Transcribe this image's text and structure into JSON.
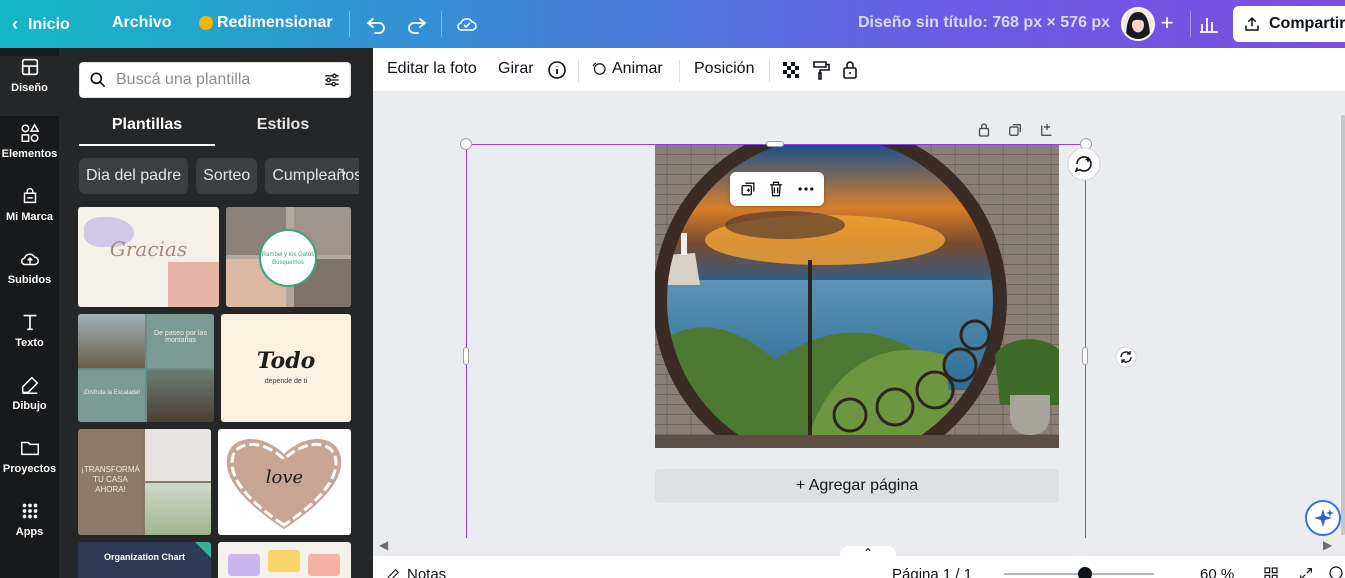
{
  "topbar": {
    "home_label": "Inicio",
    "file_label": "Archivo",
    "resize_label": "Redimensionar",
    "title": "Diseño sin título: 768 px × 576 px",
    "share_label": "Compartir"
  },
  "rail": {
    "items": [
      {
        "label": "Diseño",
        "icon": "layout-icon"
      },
      {
        "label": "Elementos",
        "icon": "shapes-icon"
      },
      {
        "label": "Mi Marca",
        "icon": "brand-icon"
      },
      {
        "label": "Subidos",
        "icon": "upload-icon"
      },
      {
        "label": "Texto",
        "icon": "text-icon"
      },
      {
        "label": "Dibujo",
        "icon": "draw-icon"
      },
      {
        "label": "Proyectos",
        "icon": "folder-icon"
      },
      {
        "label": "Apps",
        "icon": "apps-icon"
      }
    ]
  },
  "panel": {
    "search_placeholder": "Buscá una plantilla",
    "tabs": [
      "Plantillas",
      "Estilos"
    ],
    "chips": [
      "Dia del padre",
      "Sorteo",
      "Cumpleaños"
    ],
    "templates": {
      "t1": "Gracias",
      "t2_line1": "Rambel y los Gatos",
      "t2_line2": "Bosquemos",
      "t3_top": "De paseo por las montañas",
      "t3_bottom": "¡Disfruta la Escalada!",
      "t4_big": "Todo",
      "t4_small": "depende de ti",
      "t5_line1": "¡TRANSFORMÁ",
      "t5_line2": "TU CASA",
      "t5_line3": "AHORA!",
      "t6": "love",
      "t7": "Organization Chart"
    }
  },
  "ctx": {
    "edit_photo": "Editar la foto",
    "rotate": "Girar",
    "animate": "Animar",
    "position": "Posición"
  },
  "canvas": {
    "add_page": "+ Agregar página"
  },
  "bottombar": {
    "notes": "Notas",
    "page": "Página 1 / 1",
    "zoom": "60 %"
  }
}
